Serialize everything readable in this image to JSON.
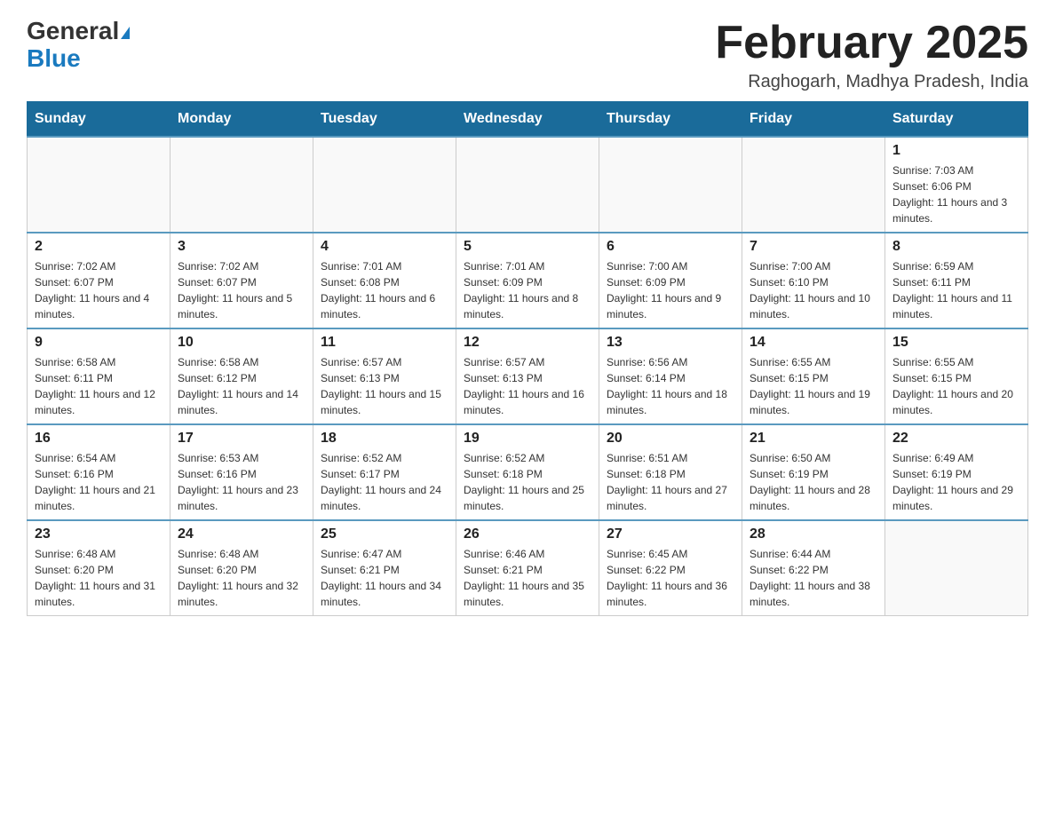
{
  "header": {
    "logo_general": "General",
    "logo_blue": "Blue",
    "month_title": "February 2025",
    "location": "Raghogarh, Madhya Pradesh, India"
  },
  "days_of_week": [
    "Sunday",
    "Monday",
    "Tuesday",
    "Wednesday",
    "Thursday",
    "Friday",
    "Saturday"
  ],
  "weeks": [
    [
      {
        "day": "",
        "info": ""
      },
      {
        "day": "",
        "info": ""
      },
      {
        "day": "",
        "info": ""
      },
      {
        "day": "",
        "info": ""
      },
      {
        "day": "",
        "info": ""
      },
      {
        "day": "",
        "info": ""
      },
      {
        "day": "1",
        "info": "Sunrise: 7:03 AM\nSunset: 6:06 PM\nDaylight: 11 hours and 3 minutes."
      }
    ],
    [
      {
        "day": "2",
        "info": "Sunrise: 7:02 AM\nSunset: 6:07 PM\nDaylight: 11 hours and 4 minutes."
      },
      {
        "day": "3",
        "info": "Sunrise: 7:02 AM\nSunset: 6:07 PM\nDaylight: 11 hours and 5 minutes."
      },
      {
        "day": "4",
        "info": "Sunrise: 7:01 AM\nSunset: 6:08 PM\nDaylight: 11 hours and 6 minutes."
      },
      {
        "day": "5",
        "info": "Sunrise: 7:01 AM\nSunset: 6:09 PM\nDaylight: 11 hours and 8 minutes."
      },
      {
        "day": "6",
        "info": "Sunrise: 7:00 AM\nSunset: 6:09 PM\nDaylight: 11 hours and 9 minutes."
      },
      {
        "day": "7",
        "info": "Sunrise: 7:00 AM\nSunset: 6:10 PM\nDaylight: 11 hours and 10 minutes."
      },
      {
        "day": "8",
        "info": "Sunrise: 6:59 AM\nSunset: 6:11 PM\nDaylight: 11 hours and 11 minutes."
      }
    ],
    [
      {
        "day": "9",
        "info": "Sunrise: 6:58 AM\nSunset: 6:11 PM\nDaylight: 11 hours and 12 minutes."
      },
      {
        "day": "10",
        "info": "Sunrise: 6:58 AM\nSunset: 6:12 PM\nDaylight: 11 hours and 14 minutes."
      },
      {
        "day": "11",
        "info": "Sunrise: 6:57 AM\nSunset: 6:13 PM\nDaylight: 11 hours and 15 minutes."
      },
      {
        "day": "12",
        "info": "Sunrise: 6:57 AM\nSunset: 6:13 PM\nDaylight: 11 hours and 16 minutes."
      },
      {
        "day": "13",
        "info": "Sunrise: 6:56 AM\nSunset: 6:14 PM\nDaylight: 11 hours and 18 minutes."
      },
      {
        "day": "14",
        "info": "Sunrise: 6:55 AM\nSunset: 6:15 PM\nDaylight: 11 hours and 19 minutes."
      },
      {
        "day": "15",
        "info": "Sunrise: 6:55 AM\nSunset: 6:15 PM\nDaylight: 11 hours and 20 minutes."
      }
    ],
    [
      {
        "day": "16",
        "info": "Sunrise: 6:54 AM\nSunset: 6:16 PM\nDaylight: 11 hours and 21 minutes."
      },
      {
        "day": "17",
        "info": "Sunrise: 6:53 AM\nSunset: 6:16 PM\nDaylight: 11 hours and 23 minutes."
      },
      {
        "day": "18",
        "info": "Sunrise: 6:52 AM\nSunset: 6:17 PM\nDaylight: 11 hours and 24 minutes."
      },
      {
        "day": "19",
        "info": "Sunrise: 6:52 AM\nSunset: 6:18 PM\nDaylight: 11 hours and 25 minutes."
      },
      {
        "day": "20",
        "info": "Sunrise: 6:51 AM\nSunset: 6:18 PM\nDaylight: 11 hours and 27 minutes."
      },
      {
        "day": "21",
        "info": "Sunrise: 6:50 AM\nSunset: 6:19 PM\nDaylight: 11 hours and 28 minutes."
      },
      {
        "day": "22",
        "info": "Sunrise: 6:49 AM\nSunset: 6:19 PM\nDaylight: 11 hours and 29 minutes."
      }
    ],
    [
      {
        "day": "23",
        "info": "Sunrise: 6:48 AM\nSunset: 6:20 PM\nDaylight: 11 hours and 31 minutes."
      },
      {
        "day": "24",
        "info": "Sunrise: 6:48 AM\nSunset: 6:20 PM\nDaylight: 11 hours and 32 minutes."
      },
      {
        "day": "25",
        "info": "Sunrise: 6:47 AM\nSunset: 6:21 PM\nDaylight: 11 hours and 34 minutes."
      },
      {
        "day": "26",
        "info": "Sunrise: 6:46 AM\nSunset: 6:21 PM\nDaylight: 11 hours and 35 minutes."
      },
      {
        "day": "27",
        "info": "Sunrise: 6:45 AM\nSunset: 6:22 PM\nDaylight: 11 hours and 36 minutes."
      },
      {
        "day": "28",
        "info": "Sunrise: 6:44 AM\nSunset: 6:22 PM\nDaylight: 11 hours and 38 minutes."
      },
      {
        "day": "",
        "info": ""
      }
    ]
  ]
}
